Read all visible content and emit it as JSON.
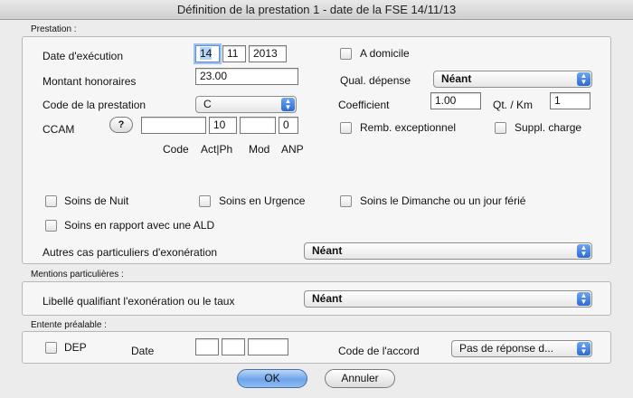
{
  "window": {
    "title": "Définition de la prestation 1 - date de la FSE 14/11/13"
  },
  "prestation": {
    "section_label": "Prestation :",
    "date_label": "Date d'exécution",
    "date_day": "14",
    "date_month": "11",
    "date_year": "2013",
    "a_domicile_label": "A domicile",
    "montant_label": "Montant honoraires",
    "montant_value": "23.00",
    "qual_depense_label": "Qual. dépense",
    "qual_depense_value": "Néant",
    "code_label": "Code de la prestation",
    "code_value": "C",
    "coefficient_label": "Coefficient",
    "coefficient_value": "1.00",
    "qt_km_label": "Qt. / Km",
    "qt_km_value": "1",
    "ccam_label": "CCAM",
    "ccam_help": "?",
    "ccam_code_value": "",
    "ccam_act_value": "10",
    "ccam_mod_value": "",
    "ccam_anp_value": "0",
    "ccam_col_code": "Code",
    "ccam_col_act": "Act|Ph",
    "ccam_col_mod": "Mod",
    "ccam_col_anp": "ANP",
    "remb_label": "Remb. exceptionnel",
    "suppl_label": "Suppl. charge",
    "soins_nuit_label": "Soins de Nuit",
    "soins_urgence_label": "Soins en Urgence",
    "soins_dimanche_label": "Soins le Dimanche ou un jour férié",
    "soins_ald_label": "Soins en rapport avec une ALD",
    "autres_cas_label": "Autres cas particuliers d'exonération",
    "autres_cas_value": "Néant"
  },
  "mentions": {
    "section_label": "Mentions particulières :",
    "libelle_label": "Libellé qualifiant l'exonération ou le taux",
    "libelle_value": "Néant"
  },
  "entente": {
    "section_label": "Entente préalable :",
    "dep_label": "DEP",
    "date_label": "Date",
    "date_day": "",
    "date_month": "",
    "date_year": "",
    "code_accord_label": "Code de l'accord",
    "code_accord_value": "Pas de réponse d..."
  },
  "buttons": {
    "ok": "OK",
    "cancel": "Annuler"
  },
  "colors": {
    "accent": "#3a78dc",
    "default_button": "#6ea4ea"
  }
}
